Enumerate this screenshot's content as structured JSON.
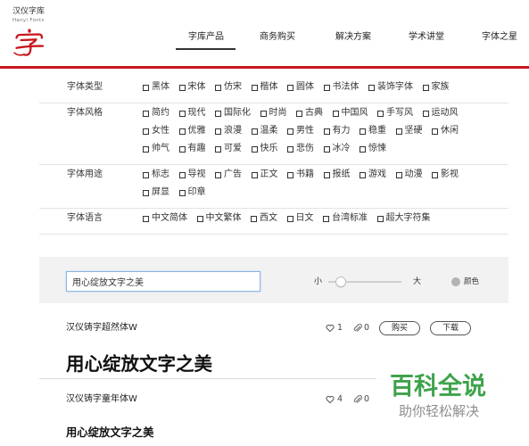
{
  "header": {
    "brand_cn": "汉仪字库",
    "brand_en": "Hanyi Fonts",
    "nav": [
      {
        "label": "字库产品",
        "active": true
      },
      {
        "label": "商务购买",
        "active": false
      },
      {
        "label": "解决方案",
        "active": false
      },
      {
        "label": "学术讲堂",
        "active": false
      },
      {
        "label": "字体之星",
        "active": false
      }
    ]
  },
  "colors": {
    "accent": "#c8161d",
    "watermark": "#3fa24c",
    "font_color_swatch": "#b3b3b3"
  },
  "icons": {
    "logo": "hanyi-logo-icon",
    "like": "heart-icon",
    "attachment": "paperclip-icon"
  },
  "filters": [
    {
      "label": "字体类型",
      "options": [
        "黑体",
        "宋体",
        "仿宋",
        "楷体",
        "圆体",
        "书法体",
        "装饰字体",
        "家族"
      ]
    },
    {
      "label": "字体风格",
      "options": [
        "简约",
        "现代",
        "国际化",
        "时尚",
        "古典",
        "中国风",
        "手写风",
        "运动风",
        "女性",
        "优雅",
        "浪漫",
        "温柔",
        "男性",
        "有力",
        "稳重",
        "坚硬",
        "休闲",
        "帅气",
        "有趣",
        "可爱",
        "快乐",
        "悲伤",
        "冰冷",
        "惊悚"
      ]
    },
    {
      "label": "字体用途",
      "options": [
        "标志",
        "导视",
        "广告",
        "正文",
        "书籍",
        "报纸",
        "游戏",
        "动漫",
        "影视",
        "屏显",
        "印章"
      ]
    },
    {
      "label": "字体语言",
      "options": [
        "中文简体",
        "中文繁体",
        "西文",
        "日文",
        "台湾标准",
        "超大字符集"
      ]
    }
  ],
  "preview": {
    "text": "用心绽放文字之美",
    "size_min_label": "小",
    "size_max_label": "大",
    "size_level": 0.17,
    "color_label": "颜色"
  },
  "fonts": [
    {
      "name": "汉仪铸字超然体W",
      "likes": "1",
      "attachments": "0",
      "buy_label": "购买",
      "download_label": "下载",
      "sample": "用心绽放文字之美"
    },
    {
      "name": "汉仪铸字童年体W",
      "likes": "4",
      "attachments": "0",
      "sample": "用心绽放文字之美"
    }
  ],
  "watermark": {
    "title": "百科全说",
    "subtitle": "助你轻松解决"
  }
}
